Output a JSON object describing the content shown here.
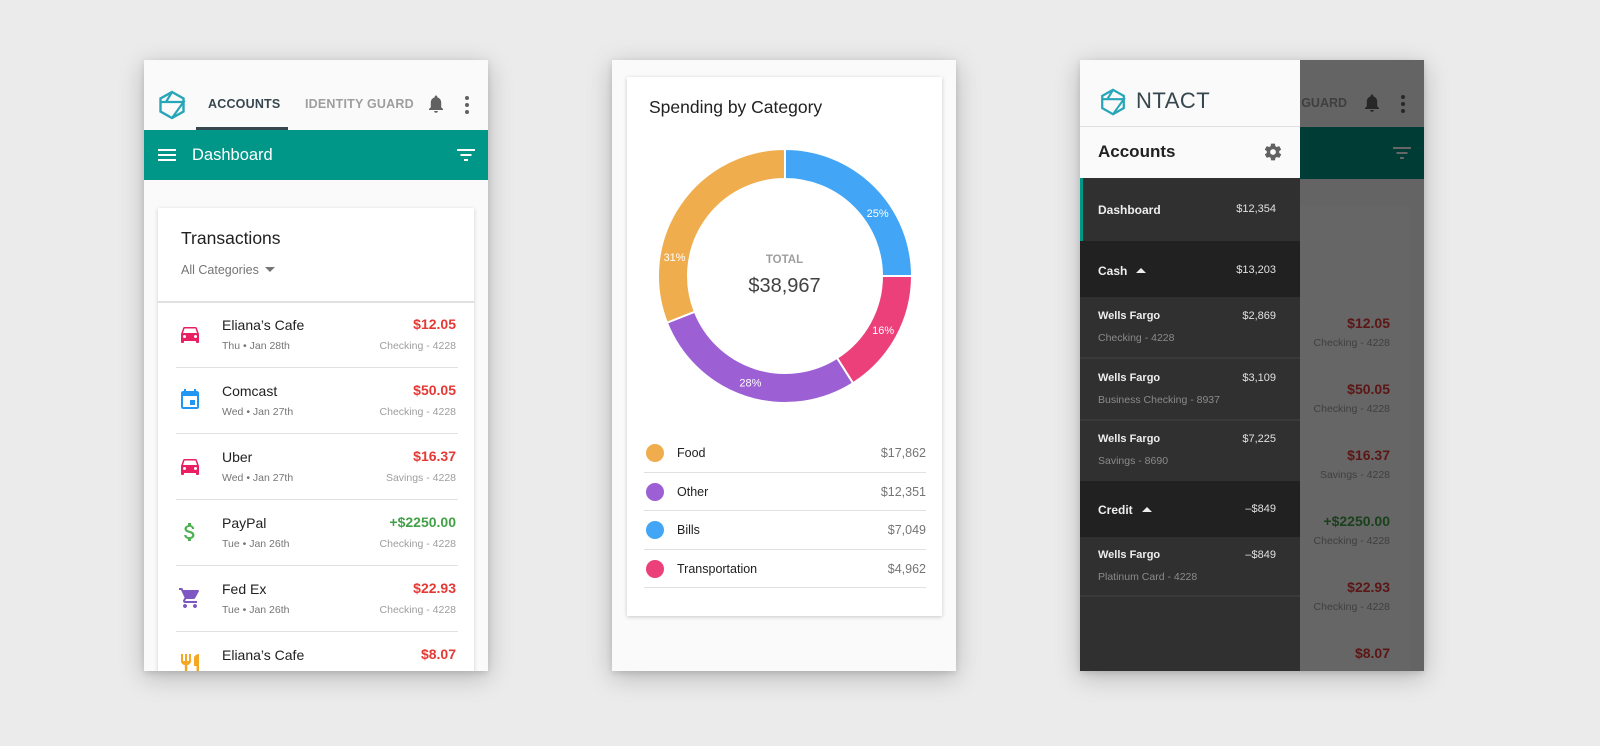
{
  "screen1": {
    "tabs": [
      {
        "label": "ACCOUNTS",
        "active": true
      },
      {
        "label": "IDENTITY GUARD",
        "active": false
      }
    ],
    "toolbar": {
      "title": "Dashboard",
      "menu_icon": "menu-icon",
      "filter_icon": "filter-icon"
    },
    "header_icons": {
      "logo": "hex-logo-icon",
      "notifications": "bell-icon",
      "more": "more-vert-icon"
    },
    "transactions": {
      "title": "Transactions",
      "category_filter": "All Categories",
      "items": [
        {
          "icon": "car-icon",
          "color": "#e91e63",
          "name": "Eliana’s Cafe",
          "date": "Thu • Jan 28th",
          "amount": "$12.05",
          "account": "Checking - 4228",
          "positive": false
        },
        {
          "icon": "calendar-icon",
          "color": "#2196f3",
          "name": "Comcast",
          "date": "Wed • Jan 27th",
          "amount": "$50.05",
          "account": "Checking - 4228",
          "positive": false
        },
        {
          "icon": "car-icon",
          "color": "#e91e63",
          "name": "Uber",
          "date": "Wed • Jan 27th",
          "amount": "$16.37",
          "account": "Savings - 4228",
          "positive": false
        },
        {
          "icon": "dollar-icon",
          "color": "#4caf50",
          "name": "PayPal",
          "date": "Tue • Jan 26th",
          "amount": "+$2250.00",
          "account": "Checking - 4228",
          "positive": true
        },
        {
          "icon": "cart-icon",
          "color": "#7e57c2",
          "name": "Fed Ex",
          "date": "Tue • Jan 26th",
          "amount": "$22.93",
          "account": "Checking - 4228",
          "positive": false
        },
        {
          "icon": "restaurant-icon",
          "color": "#f5a623",
          "name": "Eliana’s Cafe",
          "date": "",
          "amount": "$8.07",
          "account": "",
          "positive": false
        }
      ]
    }
  },
  "screen2": {
    "title": "Spending by Category",
    "total_label": "TOTAL",
    "total_value": "$38,967",
    "categories": [
      {
        "name": "Food",
        "value": "$17,862",
        "color": "#f0ad4e",
        "percent_label": "31%"
      },
      {
        "name": "Other",
        "value": "$12,351",
        "color": "#9c5fd4",
        "percent_label": "28%"
      },
      {
        "name": "Bills",
        "value": "$7,049",
        "color": "#42a5f5",
        "percent_label": "25%"
      },
      {
        "name": "Transportation",
        "value": "$4,962",
        "color": "#ec407a",
        "percent_label": "16%"
      }
    ]
  },
  "chart_data": {
    "type": "pie",
    "title": "Spending by Category",
    "center_label": "TOTAL",
    "center_value": "$38,967",
    "slices": [
      {
        "label": "Bills",
        "percent": 25,
        "color": "#42a5f5"
      },
      {
        "label": "Transportation",
        "percent": 16,
        "color": "#ec407a"
      },
      {
        "label": "Other",
        "percent": 28,
        "color": "#9c5fd4"
      },
      {
        "label": "Food",
        "percent": 31,
        "color": "#f0ad4e"
      }
    ],
    "legend": [
      {
        "label": "Food",
        "value": "$17,862"
      },
      {
        "label": "Other",
        "value": "$12,351"
      },
      {
        "label": "Bills",
        "value": "$7,049"
      },
      {
        "label": "Transportation",
        "value": "$4,962"
      }
    ]
  },
  "screen3": {
    "brand": "NTACT",
    "accounts_title": "Accounts",
    "settings_icon": "gear-icon",
    "dashboard": {
      "label": "Dashboard",
      "value": "$12,354"
    },
    "cash": {
      "label": "Cash",
      "value": "$13,203",
      "accounts": [
        {
          "bank": "Wells Fargo",
          "value": "$2,869",
          "detail": "Checking - 4228"
        },
        {
          "bank": "Wells Fargo",
          "value": "$3,109",
          "detail": "Business Checking - 8937"
        },
        {
          "bank": "Wells Fargo",
          "value": "$7,225",
          "detail": "Savings - 8690"
        }
      ]
    },
    "credit": {
      "label": "Credit",
      "value": "–$849",
      "accounts": [
        {
          "bank": "Wells Fargo",
          "value": "–$849",
          "detail": "Platinum Card - 4228"
        }
      ]
    },
    "background": {
      "tab_label": "IDENTITY GUARD",
      "amounts": [
        {
          "amount": "$12.05",
          "account": "Checking - 4228",
          "positive": false
        },
        {
          "amount": "$50.05",
          "account": "Checking - 4228",
          "positive": false
        },
        {
          "amount": "$16.37",
          "account": "Savings - 4228",
          "positive": false
        },
        {
          "amount": "+$2250.00",
          "account": "Checking - 4228",
          "positive": true
        },
        {
          "amount": "$22.93",
          "account": "Checking - 4228",
          "positive": false
        },
        {
          "amount": "$8.07",
          "account": "",
          "positive": false
        }
      ]
    }
  }
}
